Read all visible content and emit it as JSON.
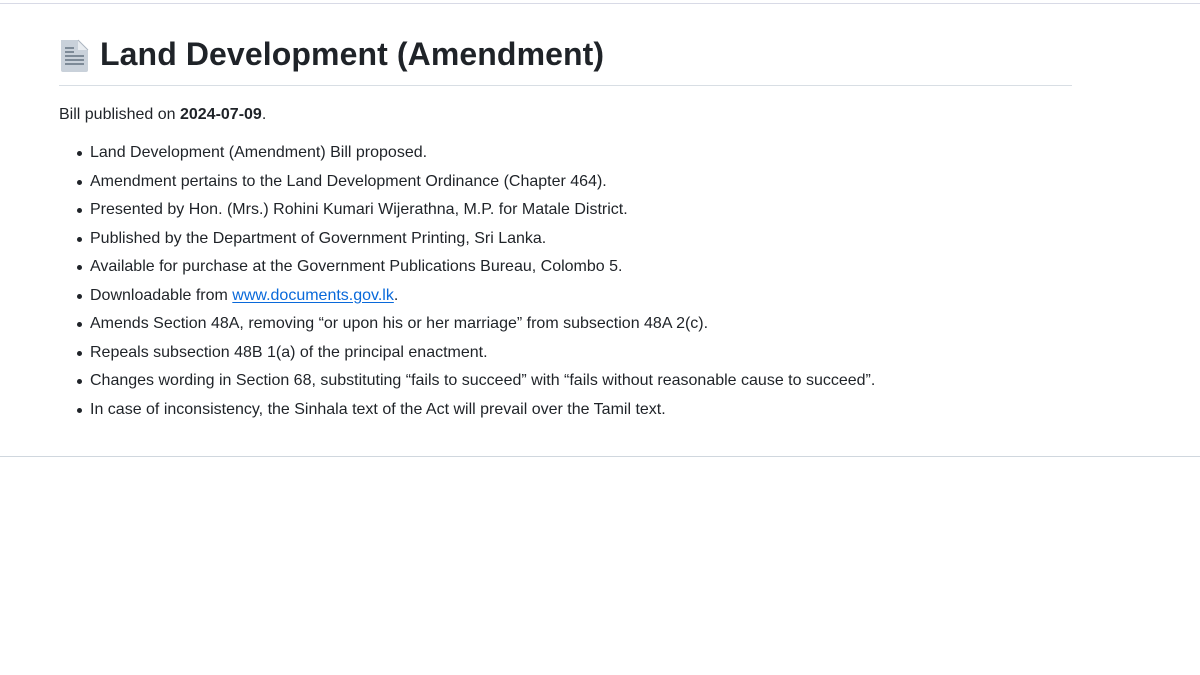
{
  "page": {
    "title": "Land Development (Amendment)",
    "title_icon": "document-icon",
    "published_prefix": "Bill published on ",
    "published_date": "2024-07-09",
    "published_suffix": "."
  },
  "facts": [
    {
      "text": "Land Development (Amendment) Bill proposed."
    },
    {
      "text": "Amendment pertains to the Land Development Ordinance (Chapter 464)."
    },
    {
      "text": "Presented by Hon. (Mrs.) Rohini Kumari Wijerathna, M.P. for Matale District."
    },
    {
      "text": "Published by the Department of Government Printing, Sri Lanka."
    },
    {
      "text": "Available for purchase at the Government Publications Bureau, Colombo 5."
    },
    {
      "prefix": "Downloadable from ",
      "link": "www.documents.gov.lk",
      "suffix": "."
    },
    {
      "text": "Amends Section 48A, removing “or upon his or her marriage” from subsection 48A 2(c)."
    },
    {
      "text": "Repeals subsection 48B 1(a) of the principal enactment."
    },
    {
      "text": "Changes wording in Section 68, substituting “fails to succeed” with “fails without reasonable cause to succeed”."
    },
    {
      "text": "In case of inconsistency, the Sinhala text of the Act will prevail over the Tamil text."
    }
  ],
  "colors": {
    "link": "#0969da",
    "text": "#1f2328",
    "rule": "#d8dee4"
  }
}
